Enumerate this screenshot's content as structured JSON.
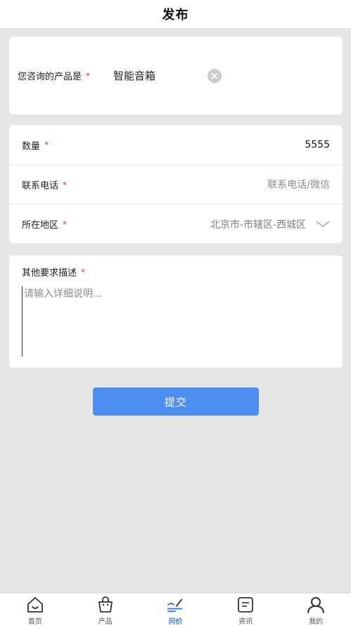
{
  "header": {
    "title": "发布"
  },
  "product": {
    "label": "您咨询的产品是",
    "required_mark": "*",
    "value": "智能音箱"
  },
  "fields": {
    "quantity": {
      "label": "数量",
      "required_mark": "*",
      "value": "5555"
    },
    "phone": {
      "label": "联系电话",
      "required_mark": "*",
      "placeholder": "联系电话/微信"
    },
    "region": {
      "label": "所在地区",
      "required_mark": "*",
      "value": "北京市-市辖区-西城区"
    }
  },
  "description": {
    "label": "其他要求描述",
    "required_mark": "*",
    "placeholder": "请输入详细说明..."
  },
  "submit_label": "提交",
  "tabbar": {
    "items": [
      {
        "label": "首页",
        "icon": "home-icon"
      },
      {
        "label": "产品",
        "icon": "bag-icon"
      },
      {
        "label": "问价",
        "icon": "pen-icon",
        "active": true
      },
      {
        "label": "资讯",
        "icon": "news-icon"
      },
      {
        "label": "我的",
        "icon": "user-icon"
      }
    ]
  },
  "colors": {
    "accent": "#4d8ef1",
    "required": "#e53935",
    "background": "#e6e6e6"
  }
}
